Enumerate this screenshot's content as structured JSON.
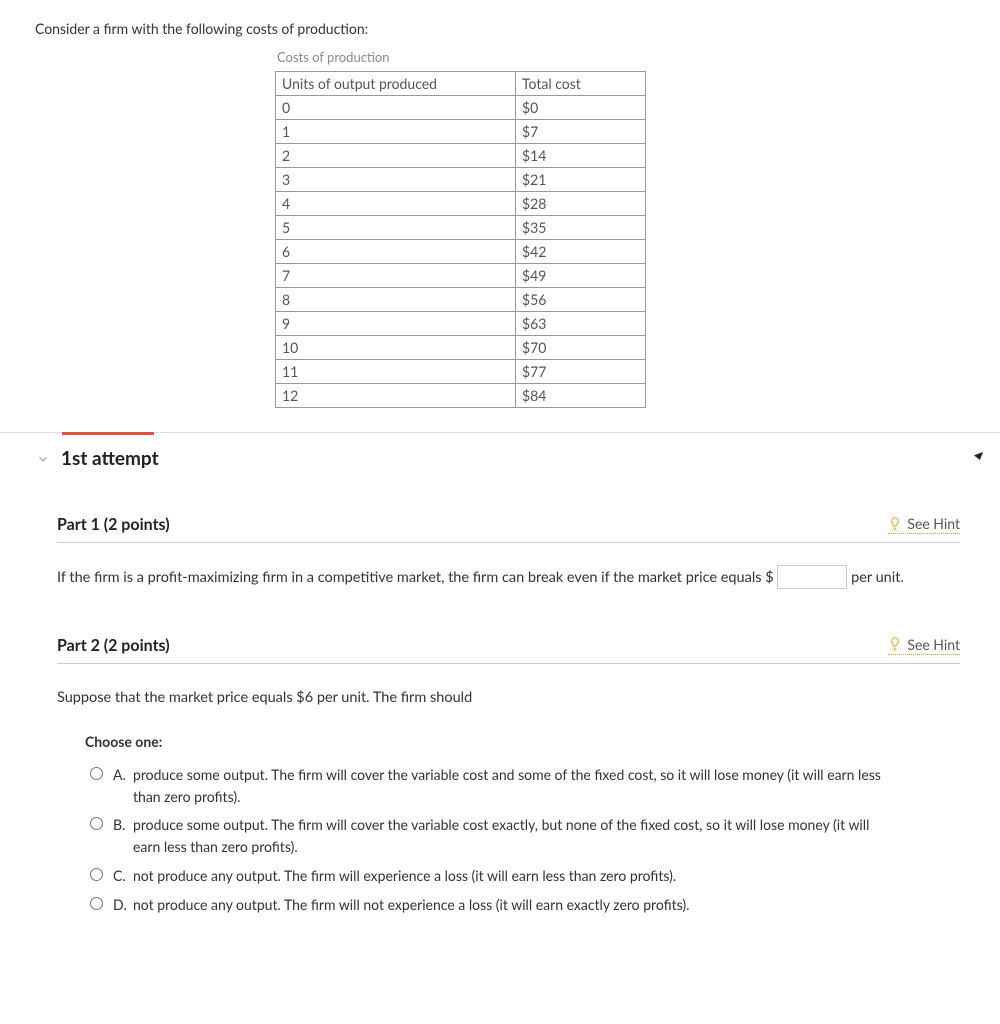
{
  "intro": "Consider a firm with the following costs of production:",
  "table": {
    "caption": "Costs of production",
    "headers": [
      "Units of output produced",
      "Total cost"
    ],
    "rows": [
      [
        "0",
        "$0"
      ],
      [
        "1",
        "$7"
      ],
      [
        "2",
        "$14"
      ],
      [
        "3",
        "$21"
      ],
      [
        "4",
        "$28"
      ],
      [
        "5",
        "$35"
      ],
      [
        "6",
        "$42"
      ],
      [
        "7",
        "$49"
      ],
      [
        "8",
        "$56"
      ],
      [
        "9",
        "$63"
      ],
      [
        "10",
        "$70"
      ],
      [
        "11",
        "$77"
      ],
      [
        "12",
        "$84"
      ]
    ]
  },
  "attempt_label": "1st attempt",
  "hint_label": "See Hint",
  "part1": {
    "title": "Part 1   (2 points)",
    "text_before": "If the firm is a profit-maximizing firm in a competitive market, the firm can break even if the market price equals $",
    "text_after": " per unit."
  },
  "part2": {
    "title": "Part 2   (2 points)",
    "prompt": "Suppose that the market price equals $6 per unit. The firm should",
    "choose_one": "Choose one:",
    "options": [
      {
        "letter": "A.",
        "text": "produce some output. The firm will cover the variable cost and some of the fixed cost, so it will lose money (it will earn less than zero profits)."
      },
      {
        "letter": "B.",
        "text": "produce some output. The firm will cover the variable cost exactly, but none of the fixed cost, so it will lose money (it will earn less than zero profits)."
      },
      {
        "letter": "C.",
        "text": "not produce any output. The firm will experience a loss (it will earn less than zero profits)."
      },
      {
        "letter": "D.",
        "text": "not produce any output. The firm will not experience a loss (it will earn exactly zero profits)."
      }
    ]
  },
  "chart_data": {
    "type": "table",
    "title": "Costs of production",
    "columns": [
      "Units of output produced",
      "Total cost ($)"
    ],
    "rows": [
      [
        0,
        0
      ],
      [
        1,
        7
      ],
      [
        2,
        14
      ],
      [
        3,
        21
      ],
      [
        4,
        28
      ],
      [
        5,
        35
      ],
      [
        6,
        42
      ],
      [
        7,
        49
      ],
      [
        8,
        56
      ],
      [
        9,
        63
      ],
      [
        10,
        70
      ],
      [
        11,
        77
      ],
      [
        12,
        84
      ]
    ]
  }
}
